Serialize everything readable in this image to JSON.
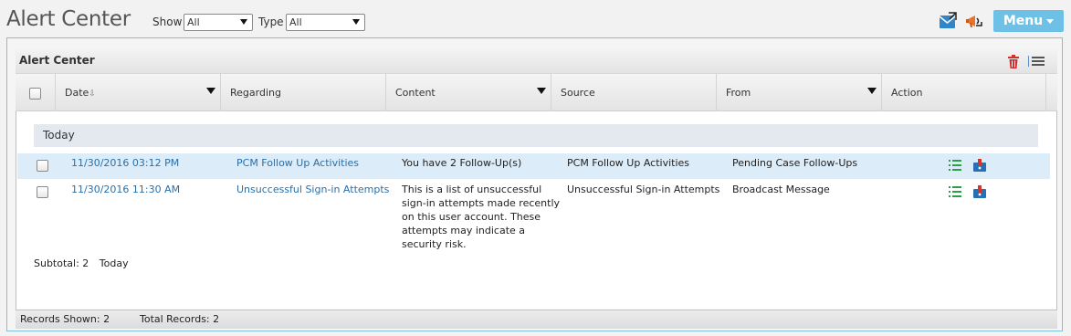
{
  "header": {
    "title": "Alert Center",
    "show_label": "Show",
    "show_value": "All",
    "type_label": "Type",
    "type_value": "All",
    "menu_label": "Menu"
  },
  "panel": {
    "title": "Alert Center"
  },
  "columns": {
    "date": "Date",
    "regarding": "Regarding",
    "content": "Content",
    "source": "Source",
    "from": "From",
    "action": "Action"
  },
  "group": {
    "label": "Today",
    "subtotal_label": "Subtotal: 2",
    "subtotal_group": "Today"
  },
  "rows": [
    {
      "date": "11/30/2016 03:12 PM",
      "regarding": "PCM Follow Up Activities",
      "content": "You have 2 Follow-Up(s)",
      "source": "PCM Follow Up Activities",
      "from": "Pending Case Follow-Ups",
      "selected": true
    },
    {
      "date": "11/30/2016 11:30 AM",
      "regarding": "Unsuccessful Sign-in Attempts",
      "content": "This is a list of unsuccessful sign-in attempts made recently on this user account. These attempts may indicate a security risk.",
      "content_lines": [
        "This is a list of unsuccessful",
        "sign-in attempts made recently",
        "on this user account. These",
        "attempts may indicate a",
        "security risk."
      ],
      "source": "Unsuccessful Sign-in Attempts",
      "from": "Broadcast Message",
      "selected": false
    }
  ],
  "footer": {
    "records_shown": "Records Shown: 2",
    "total_records": "Total Records: 2"
  },
  "colors": {
    "accent": "#6ec1e6",
    "link": "#2a6fa8",
    "selected_row": "#dcecf8"
  }
}
